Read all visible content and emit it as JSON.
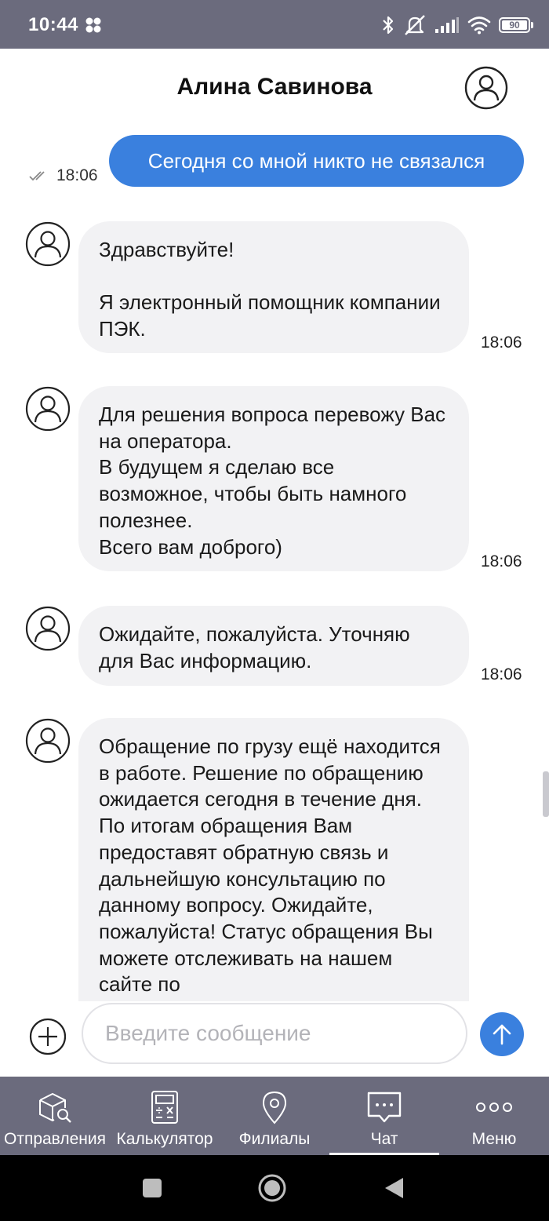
{
  "status_bar": {
    "time": "10:44",
    "battery": "90",
    "icons": [
      "app-icon",
      "bluetooth-icon",
      "mute-icon",
      "signal-icon",
      "wifi-icon",
      "battery-icon"
    ]
  },
  "header": {
    "title": "Алина Савинова",
    "avatar_icon": "user-avatar-icon"
  },
  "messages": {
    "outgoing": {
      "text": "Сегодня со мной никто не связался",
      "time": "18:06",
      "status_icon": "double-check-icon"
    },
    "incoming": [
      {
        "text": "Здравствуйте!\n\nЯ электронный помощник компании ПЭК.",
        "time": "18:06"
      },
      {
        "text": "Для решения вопроса перевожу Вас на оператора.\nВ будущем я сделаю все возможное, чтобы быть намного полезнее.\nВсего вам доброго)",
        "time": "18:06"
      },
      {
        "text": "Ожидайте, пожалуйста. Уточняю для Вас информацию.",
        "time": "18:06"
      },
      {
        "text": "Обращение по грузу ещё находится в работе. Решение по обращению ожидается сегодня в течение дня. По итогам обращения Вам предоставят обратную связь и дальнейшую консультацию по данному вопросу. Ожидайте, пожалуйста! Статус обращения Вы можете отслеживать на нашем сайте по",
        "time": ""
      }
    ]
  },
  "composer": {
    "placeholder": "Введите сообщение",
    "value": "",
    "add_icon": "plus-circle-icon",
    "send_icon": "arrow-up-icon"
  },
  "bottom_nav": {
    "items": [
      {
        "label": "Отправления",
        "icon": "package-search-icon",
        "active": false
      },
      {
        "label": "Калькулятор",
        "icon": "calculator-icon",
        "active": false
      },
      {
        "label": "Филиалы",
        "icon": "map-pin-icon",
        "active": false
      },
      {
        "label": "Чат",
        "icon": "chat-icon",
        "active": true
      },
      {
        "label": "Меню",
        "icon": "more-dots-icon",
        "active": false
      }
    ]
  },
  "system_nav": {
    "buttons": [
      "recents-square-icon",
      "home-circle-icon",
      "back-triangle-icon"
    ]
  },
  "colors": {
    "bars": "#6b6b7d",
    "accent": "#3a80de",
    "incoming_bubble": "#f2f2f4"
  }
}
